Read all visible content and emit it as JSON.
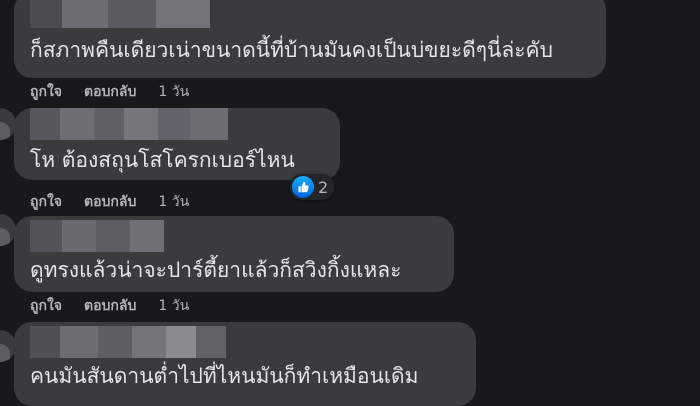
{
  "comments": [
    {
      "text": "ก็สภาพคืนเดียวเน่าขนาดนี้ที่บ้านมันคงเป็นบ่ขยะดีๆนี่ล่ะคับ",
      "actions": {
        "like": "ถูกใจ",
        "reply": "ตอบกลับ",
        "time": "1 วัน"
      }
    },
    {
      "text": "โห ต้องสถุนโสโครกเบอร์ไหน",
      "actions": {
        "like": "ถูกใจ",
        "reply": "ตอบกลับ",
        "time": "1 วัน"
      },
      "reaction": {
        "icon": "like-icon",
        "count": "2"
      }
    },
    {
      "text": "ดูทรงแล้วน่าจะปาร์ตี้ยาแล้วก็สวิงกิ้งแหละ",
      "actions": {
        "like": "ถูกใจ",
        "reply": "ตอบกลับ",
        "time": "1 วัน"
      }
    },
    {
      "text": "คนมันสันดานต่ำไปที่ไหนมันก็ทำเหมือนเดิม"
    }
  ],
  "colors": {
    "background": "#18191a",
    "bubble": "#3a3b3c",
    "text": "#e4e6eb",
    "secondary_text": "#b0b3b8",
    "like_blue": "#0062df"
  }
}
